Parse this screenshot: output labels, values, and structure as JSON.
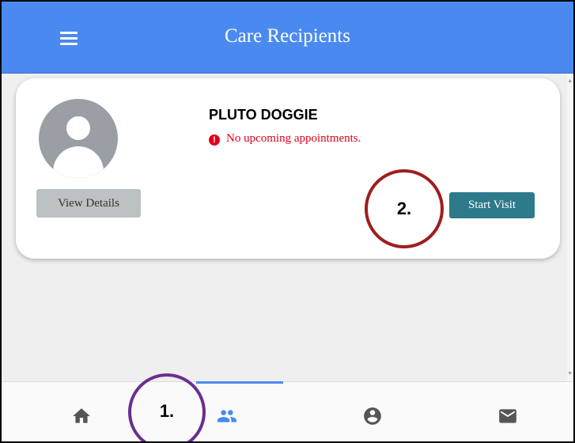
{
  "appbar": {
    "title": "Care Recipients"
  },
  "card": {
    "name": "PLUTO DOGGIE",
    "appointment_status": "No upcoming appointments.",
    "view_details_label": "View Details",
    "start_visit_label": "Start Visit"
  },
  "callouts": {
    "one": "1.",
    "two": "2."
  },
  "bottom_nav": {
    "items": [
      {
        "icon": "home-icon",
        "active": false
      },
      {
        "icon": "people-icon",
        "active": true
      },
      {
        "icon": "account-circle-icon",
        "active": false
      },
      {
        "icon": "mail-icon",
        "active": false
      }
    ]
  },
  "colors": {
    "appbar": "#4a8af0",
    "start_visit": "#2c7a8a",
    "alert": "#e0001a",
    "callout_one": "#6b2d90",
    "callout_two": "#a01d1d"
  }
}
